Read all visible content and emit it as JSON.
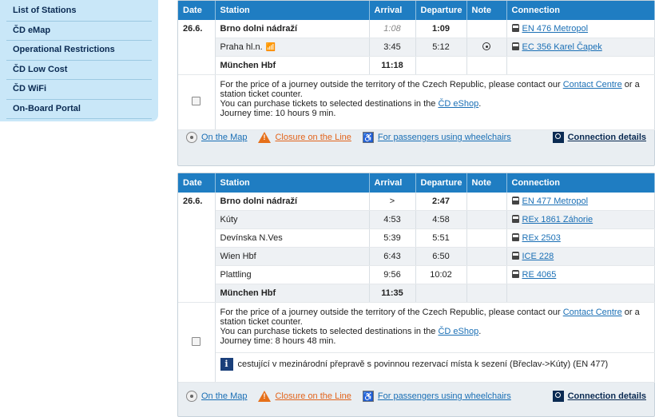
{
  "sidebar": {
    "items": [
      {
        "label": "List of Stations"
      },
      {
        "label": "ČD eMap"
      },
      {
        "label": "Operational Restrictions"
      },
      {
        "label": "ČD Low Cost"
      },
      {
        "label": "ČD WiFi"
      },
      {
        "label": "On-Board Portal"
      }
    ]
  },
  "headers": {
    "date": "Date",
    "station": "Station",
    "arrival": "Arrival",
    "departure": "Departure",
    "note": "Note",
    "connection": "Connection"
  },
  "info": {
    "line1_a": "For the price of a journey outside the territory of the Czech Republic, please contact our",
    "contact_link": "Contact Centre",
    "line1_b": "or a station ticket counter.",
    "line2_a": "You can purchase tickets to selected destinations in the",
    "eshop_link": "ČD eShop",
    "line2_b": "."
  },
  "footer": {
    "map": "On the Map",
    "closure": "Closure on the Line",
    "wheelchair": "For passengers using wheelchairs",
    "details": "Connection details"
  },
  "connection1": {
    "date": "26.6.",
    "rows": [
      {
        "station": "Brno dolni nádraží",
        "arrival": "1:08",
        "departure": "1:09",
        "train": "EN 476 Metropol"
      },
      {
        "station": "Praha hl.n.",
        "arrival": "3:45",
        "departure": "5:12",
        "train": "EC 356 Karel Čapek"
      },
      {
        "station": "München Hbf",
        "arrival": "11:18",
        "departure": ""
      }
    ],
    "journey_time": "Journey time: 10 hours 9 min."
  },
  "connection2": {
    "date": "26.6.",
    "rows": [
      {
        "station": "Brno dolni nádraží",
        "arrival": ">",
        "departure": "2:47",
        "train": "EN 477 Metropol"
      },
      {
        "station": "Kúty",
        "arrival": "4:53",
        "departure": "4:58",
        "train": "REx 1861 Záhorie"
      },
      {
        "station": "Devínska N.Ves",
        "arrival": "5:39",
        "departure": "5:51",
        "train": "REx 2503"
      },
      {
        "station": "Wien Hbf",
        "arrival": "6:43",
        "departure": "6:50",
        "train": "ICE 228"
      },
      {
        "station": "Plattling",
        "arrival": "9:56",
        "departure": "10:02",
        "train": "RE 4065"
      },
      {
        "station": "München Hbf",
        "arrival": "11:35",
        "departure": ""
      }
    ],
    "journey_time": "Journey time: 8 hours 48 min.",
    "notice": "cestující v mezinárodní přepravě s povinnou rezervací místa k sezení (Břeclav->Kúty) (EN 477)"
  }
}
